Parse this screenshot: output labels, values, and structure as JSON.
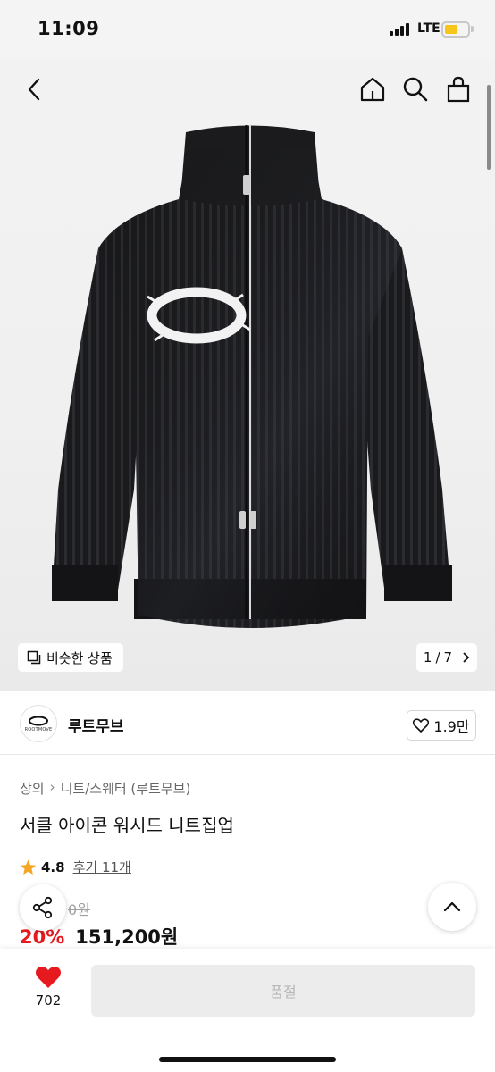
{
  "status_bar": {
    "time": "11:09",
    "network": "LTE"
  },
  "header": {
    "back_icon": "chevron-left-icon",
    "home_icon": "home-icon",
    "search_icon": "search-icon",
    "cart_icon": "shopping-bag-icon"
  },
  "gallery": {
    "similar_label": "비슷한 상품",
    "page_current": "1",
    "page_total": "7"
  },
  "brand": {
    "name": "루트무브",
    "logo_text": "ROOTMOVE",
    "likes": "1.9만"
  },
  "breadcrumb": [
    "상의",
    "니트/스웨터 (루트무브)"
  ],
  "product": {
    "title": "서클 아이콘 워시드 니트집업",
    "rating": "4.8",
    "reviews_label": "후기 11개",
    "original_price": "0원",
    "discount": "20%",
    "price": "151,200원"
  },
  "bottom_bar": {
    "wish_count": "702",
    "buy_label": "품절"
  },
  "colors": {
    "accent_red": "#e6191f",
    "star": "#f5a623",
    "battery": "#f6c51a"
  }
}
